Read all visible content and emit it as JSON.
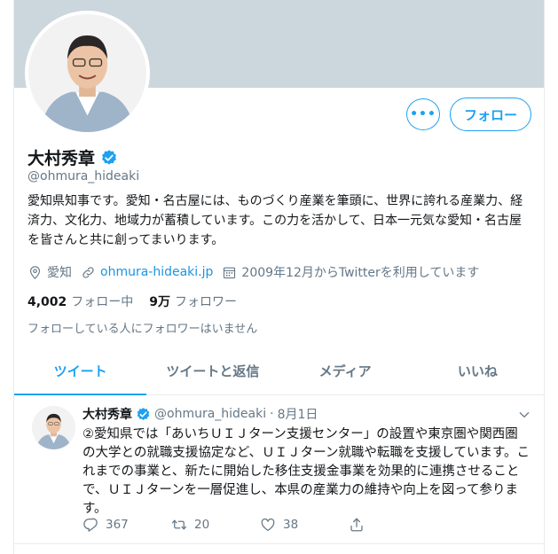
{
  "profile": {
    "name": "大村秀章",
    "handle": "@ohmura_hideaki",
    "bio": "愛知県知事です。愛知・名古屋には、ものづくり産業を筆頭に、世界に誇れる産業力、経済力、文化力、地域力が蓄積しています。この力を活かして、日本一元気な愛知・名古屋を皆さんと共に創ってまいります。",
    "location": "愛知",
    "website": "ohmura-hideaki.jp",
    "joined": "2009年12月からTwitterを利用しています",
    "following_count": "4,002",
    "following_label": "フォロー中",
    "followers_count": "9万",
    "followers_label": "フォロワー",
    "no_mutuals": "フォローしている人にフォロワーはいません"
  },
  "buttons": {
    "more": "•••",
    "follow": "フォロー"
  },
  "tabs": [
    {
      "label": "ツイート",
      "active": true
    },
    {
      "label": "ツイートと返信",
      "active": false
    },
    {
      "label": "メディア",
      "active": false
    },
    {
      "label": "いいね",
      "active": false
    }
  ],
  "tweet": {
    "name": "大村秀章",
    "handle": "@ohmura_hideaki",
    "dot": "·",
    "date": "8月1日",
    "text": "②愛知県では「あいちＵＩＪターン支援センター」の設置や東京圏や関西圏の大学との就職支援協定など、ＵＩＪターン就職や転職を支援しています。これまでの事業と、新たに開始した移住支援金事業を効果的に連携させることで、ＵＩＪターンを一層促進し、本県の産業力の維持や向上を図って参ります。",
    "replies": "367",
    "retweets": "20",
    "likes": "38"
  },
  "icons": {
    "location": "location-pin-icon",
    "link": "link-icon",
    "calendar": "calendar-icon",
    "verified": "verified-badge-icon",
    "chevron": "chevron-down-icon",
    "reply": "reply-icon",
    "retweet": "retweet-icon",
    "like": "heart-icon",
    "share": "share-icon"
  },
  "colors": {
    "accent": "#1da1f2",
    "banner": "#ccd6dd",
    "muted": "#657786",
    "text": "#14171a",
    "link": "#1b95e0"
  }
}
